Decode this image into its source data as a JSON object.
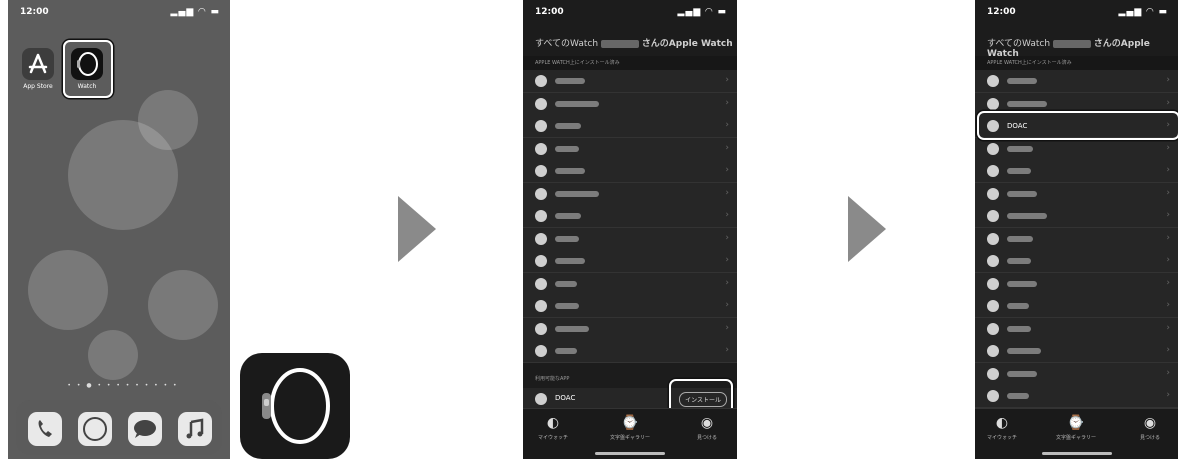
{
  "phone1": {
    "time": "12:00",
    "apps": [
      {
        "label": "App Store"
      },
      {
        "label": "Watch"
      }
    ]
  },
  "phone2": {
    "time": "12:00",
    "nav": {
      "back": "すべてのWatch",
      "title_suffix": "さんのApple Watch"
    },
    "installed_header": "APPLE WATCH上にインストール済み",
    "available_header": "利用可能なAPP",
    "available_app": {
      "name": "DOAC",
      "button": "インストール"
    },
    "tabs": [
      "マイウォッチ",
      "文字盤ギャラリー",
      "見つける"
    ]
  },
  "phone3": {
    "time": "12:00",
    "nav": {
      "back": "すべてのWatch",
      "title_suffix": "さんのApple Watch"
    },
    "installed_header": "APPLE WATCH上にインストール済み",
    "highlight_app": "DOAC",
    "tabs": [
      "マイウォッチ",
      "文字盤ギャラリー",
      "見つける"
    ]
  },
  "colors": {
    "dark_bg": "#1c1c1c",
    "row_bg": "#262626",
    "highlight": "#ffffff",
    "arrow": "#8a8a8a"
  }
}
